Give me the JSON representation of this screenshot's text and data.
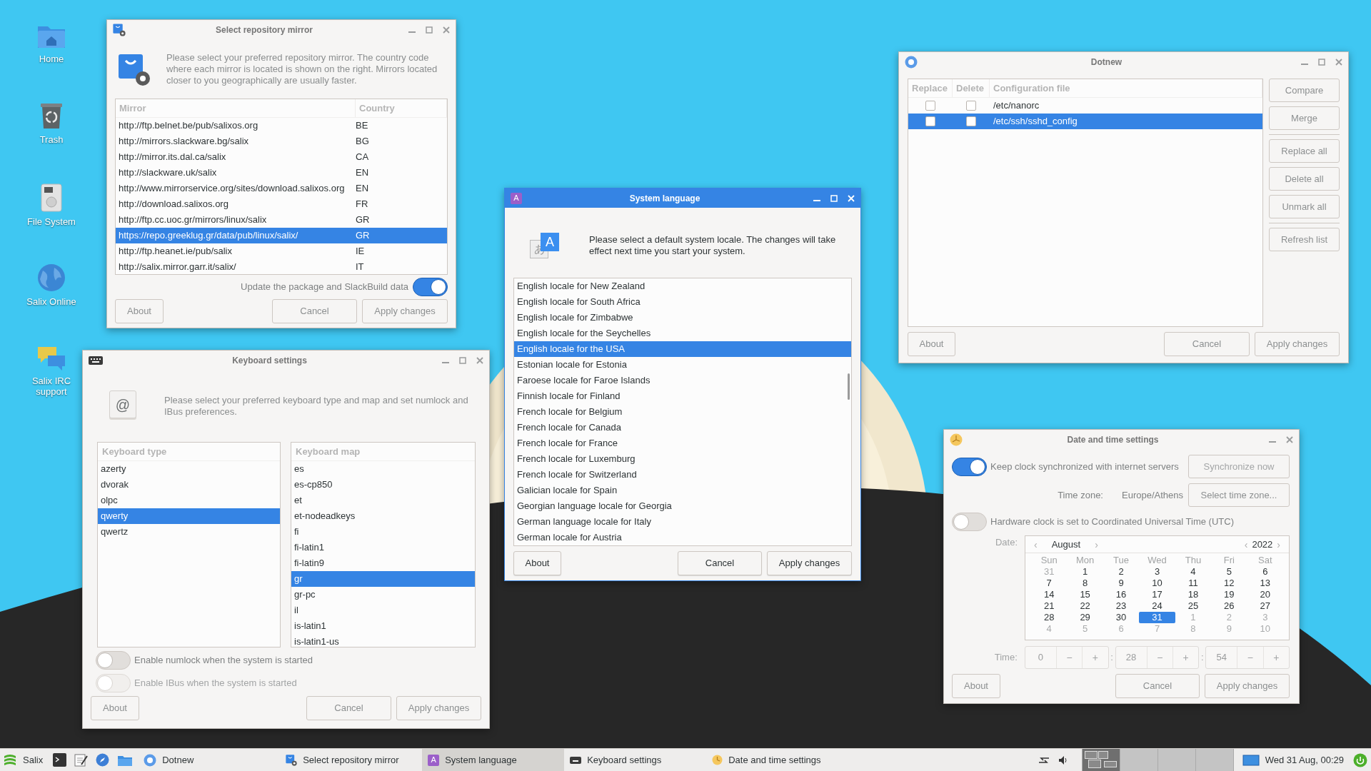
{
  "desktop_icons": [
    {
      "label": "Home"
    },
    {
      "label": "Trash"
    },
    {
      "label": "File System"
    },
    {
      "label": "Salix Online"
    },
    {
      "label": "Salix IRC support"
    }
  ],
  "repo_mirror": {
    "title": "Select repository mirror",
    "active": false,
    "description": "Please select your preferred repository mirror. The country code where each mirror is located is shown on the right. Mirrors located closer to you geographically are usually faster.",
    "columns": [
      "Mirror",
      "Country"
    ],
    "rows": [
      {
        "mirror": "http://ftp.belnet.be/pub/salixos.org",
        "country": "BE",
        "selected": false
      },
      {
        "mirror": "http://mirrors.slackware.bg/salix",
        "country": "BG",
        "selected": false
      },
      {
        "mirror": "http://mirror.its.dal.ca/salix",
        "country": "CA",
        "selected": false
      },
      {
        "mirror": "http://slackware.uk/salix",
        "country": "EN",
        "selected": false
      },
      {
        "mirror": "http://www.mirrorservice.org/sites/download.salixos.org",
        "country": "EN",
        "selected": false
      },
      {
        "mirror": "http://download.salixos.org",
        "country": "FR",
        "selected": false
      },
      {
        "mirror": "http://ftp.cc.uoc.gr/mirrors/linux/salix",
        "country": "GR",
        "selected": false
      },
      {
        "mirror": "https://repo.greeklug.gr/data/pub/linux/salix/",
        "country": "GR",
        "selected": true
      },
      {
        "mirror": "http://ftp.heanet.ie/pub/salix",
        "country": "IE",
        "selected": false
      },
      {
        "mirror": "http://salix.mirror.garr.it/salix/",
        "country": "IT",
        "selected": false
      }
    ],
    "update_toggle": {
      "label": "Update the package and SlackBuild data",
      "on": true
    },
    "buttons": {
      "about": "About",
      "cancel": "Cancel",
      "apply": "Apply changes"
    }
  },
  "keyboard": {
    "title": "Keyboard settings",
    "active": false,
    "key_glyph": "@",
    "description": "Please select your preferred keyboard type and map and set numlock and IBus preferences.",
    "type_header": "Keyboard type",
    "types": [
      {
        "label": "azerty",
        "selected": false
      },
      {
        "label": "dvorak",
        "selected": false
      },
      {
        "label": "olpc",
        "selected": false
      },
      {
        "label": "qwerty",
        "selected": true
      },
      {
        "label": "qwertz",
        "selected": false
      }
    ],
    "map_header": "Keyboard map",
    "maps": [
      {
        "label": "es",
        "selected": false
      },
      {
        "label": "es-cp850",
        "selected": false
      },
      {
        "label": "et",
        "selected": false
      },
      {
        "label": "et-nodeadkeys",
        "selected": false
      },
      {
        "label": "fi",
        "selected": false
      },
      {
        "label": "fi-latin1",
        "selected": false
      },
      {
        "label": "fi-latin9",
        "selected": false
      },
      {
        "label": "gr",
        "selected": true
      },
      {
        "label": "gr-pc",
        "selected": false
      },
      {
        "label": "il",
        "selected": false
      },
      {
        "label": "is-latin1",
        "selected": false
      },
      {
        "label": "is-latin1-us",
        "selected": false
      }
    ],
    "toggles": [
      {
        "label": "Enable numlock when the system is started",
        "on": false,
        "disabled": false
      },
      {
        "label": "Enable IBus when the system is started",
        "on": false,
        "disabled": true
      }
    ],
    "buttons": {
      "about": "About",
      "cancel": "Cancel",
      "apply": "Apply changes"
    }
  },
  "language": {
    "title": "System language",
    "active": true,
    "icon_glyph": "A",
    "big_icon_glyphs": [
      "あ",
      "A"
    ],
    "description": "Please select a default system locale. The changes will take effect next time you start your system.",
    "locales": [
      {
        "label": "English locale for New Zealand",
        "selected": false
      },
      {
        "label": "English locale for South Africa",
        "selected": false
      },
      {
        "label": "English locale for Zimbabwe",
        "selected": false
      },
      {
        "label": "English locale for the Seychelles",
        "selected": false
      },
      {
        "label": "English locale for the USA",
        "selected": true
      },
      {
        "label": "Estonian locale for Estonia",
        "selected": false
      },
      {
        "label": "Faroese locale for Faroe Islands",
        "selected": false
      },
      {
        "label": "Finnish locale for Finland",
        "selected": false
      },
      {
        "label": "French locale for Belgium",
        "selected": false
      },
      {
        "label": "French locale for Canada",
        "selected": false
      },
      {
        "label": "French locale for France",
        "selected": false
      },
      {
        "label": "French locale for Luxemburg",
        "selected": false
      },
      {
        "label": "French locale for Switzerland",
        "selected": false
      },
      {
        "label": "Galician locale for Spain",
        "selected": false
      },
      {
        "label": "Georgian language locale for Georgia",
        "selected": false
      },
      {
        "label": "German language locale for Italy",
        "selected": false
      },
      {
        "label": "German locale for Austria",
        "selected": false
      }
    ],
    "buttons": {
      "about": "About",
      "cancel": "Cancel",
      "apply": "Apply changes"
    }
  },
  "dotnew": {
    "title": "Dotnew",
    "active": false,
    "columns": [
      "Replace",
      "Delete",
      "Configuration file"
    ],
    "rows": [
      {
        "replace": false,
        "delete": false,
        "file": "/etc/nanorc",
        "selected": false
      },
      {
        "replace": false,
        "delete": false,
        "file": "/etc/ssh/sshd_config",
        "selected": true
      }
    ],
    "side_buttons": [
      [
        "Compare",
        "Merge"
      ],
      [
        "Replace all",
        "Delete all",
        "Unmark all"
      ],
      [
        "Refresh list"
      ]
    ],
    "buttons": {
      "about": "About",
      "cancel": "Cancel",
      "apply": "Apply changes"
    }
  },
  "datetime": {
    "title": "Date and time settings",
    "active": false,
    "sync_toggle": {
      "label": "Keep clock synchronized with internet servers",
      "on": true
    },
    "sync_button": {
      "label": "Synchronize now",
      "disabled": true
    },
    "timezone_label": "Time zone:",
    "timezone": "Europe/Athens",
    "timezone_button": "Select time zone...",
    "hwclock_toggle": {
      "label": "Hardware clock is set to Coordinated Universal Time (UTC)",
      "on": false
    },
    "date_label": "Date:",
    "calendar": {
      "month_prev": "‹",
      "month": "August",
      "month_next": "›",
      "year_prev": "‹",
      "year": "2022",
      "year_next": "›",
      "weekdays": [
        "Sun",
        "Mon",
        "Tue",
        "Wed",
        "Thu",
        "Fri",
        "Sat"
      ],
      "days": [
        {
          "day": "31",
          "other_month": true,
          "selected": false
        },
        {
          "day": "1",
          "other_month": false,
          "selected": false
        },
        {
          "day": "2",
          "other_month": false,
          "selected": false
        },
        {
          "day": "3",
          "other_month": false,
          "selected": false
        },
        {
          "day": "4",
          "other_month": false,
          "selected": false
        },
        {
          "day": "5",
          "other_month": false,
          "selected": false
        },
        {
          "day": "6",
          "other_month": false,
          "selected": false
        },
        {
          "day": "7",
          "other_month": false,
          "selected": false
        },
        {
          "day": "8",
          "other_month": false,
          "selected": false
        },
        {
          "day": "9",
          "other_month": false,
          "selected": false
        },
        {
          "day": "10",
          "other_month": false,
          "selected": false
        },
        {
          "day": "11",
          "other_month": false,
          "selected": false
        },
        {
          "day": "12",
          "other_month": false,
          "selected": false
        },
        {
          "day": "13",
          "other_month": false,
          "selected": false
        },
        {
          "day": "14",
          "other_month": false,
          "selected": false
        },
        {
          "day": "15",
          "other_month": false,
          "selected": false
        },
        {
          "day": "16",
          "other_month": false,
          "selected": false
        },
        {
          "day": "17",
          "other_month": false,
          "selected": false
        },
        {
          "day": "18",
          "other_month": false,
          "selected": false
        },
        {
          "day": "19",
          "other_month": false,
          "selected": false
        },
        {
          "day": "20",
          "other_month": false,
          "selected": false
        },
        {
          "day": "21",
          "other_month": false,
          "selected": false
        },
        {
          "day": "22",
          "other_month": false,
          "selected": false
        },
        {
          "day": "23",
          "other_month": false,
          "selected": false
        },
        {
          "day": "24",
          "other_month": false,
          "selected": false
        },
        {
          "day": "25",
          "other_month": false,
          "selected": false
        },
        {
          "day": "26",
          "other_month": false,
          "selected": false
        },
        {
          "day": "27",
          "other_month": false,
          "selected": false
        },
        {
          "day": "28",
          "other_month": false,
          "selected": false
        },
        {
          "day": "29",
          "other_month": false,
          "selected": false
        },
        {
          "day": "30",
          "other_month": false,
          "selected": false
        },
        {
          "day": "31",
          "other_month": false,
          "selected": true
        },
        {
          "day": "1",
          "other_month": true,
          "selected": false
        },
        {
          "day": "2",
          "other_month": true,
          "selected": false
        },
        {
          "day": "3",
          "other_month": true,
          "selected": false
        },
        {
          "day": "4",
          "other_month": true,
          "selected": false
        },
        {
          "day": "5",
          "other_month": true,
          "selected": false
        },
        {
          "day": "6",
          "other_month": true,
          "selected": false
        },
        {
          "day": "7",
          "other_month": true,
          "selected": false
        },
        {
          "day": "8",
          "other_month": true,
          "selected": false
        },
        {
          "day": "9",
          "other_month": true,
          "selected": false
        },
        {
          "day": "10",
          "other_month": true,
          "selected": false
        }
      ]
    },
    "time_label": "Time:",
    "time_fields": [
      {
        "value": "0",
        "minus": "−",
        "plus": "+"
      },
      {
        "value": "28",
        "minus": "−",
        "plus": "+"
      },
      {
        "value": "54",
        "minus": "−",
        "plus": "+"
      }
    ],
    "separators": [
      ":",
      ":"
    ],
    "buttons": {
      "about": "About",
      "cancel": "Cancel",
      "apply": "Apply changes"
    }
  },
  "taskbar": {
    "start_label": "Salix",
    "tasks": [
      {
        "label": "Dotnew",
        "selected": false
      },
      {
        "label": "Select repository mirror",
        "selected": false
      },
      {
        "label": "System language",
        "selected": true,
        "icon_glyph": "A"
      },
      {
        "label": "Keyboard settings",
        "selected": false
      },
      {
        "label": "Date and time settings",
        "selected": false
      }
    ],
    "workspaces": [
      {
        "selected": true
      },
      {
        "selected": false
      },
      {
        "selected": false
      },
      {
        "selected": false
      }
    ],
    "clock": "Wed 31 Aug, 00:29"
  }
}
